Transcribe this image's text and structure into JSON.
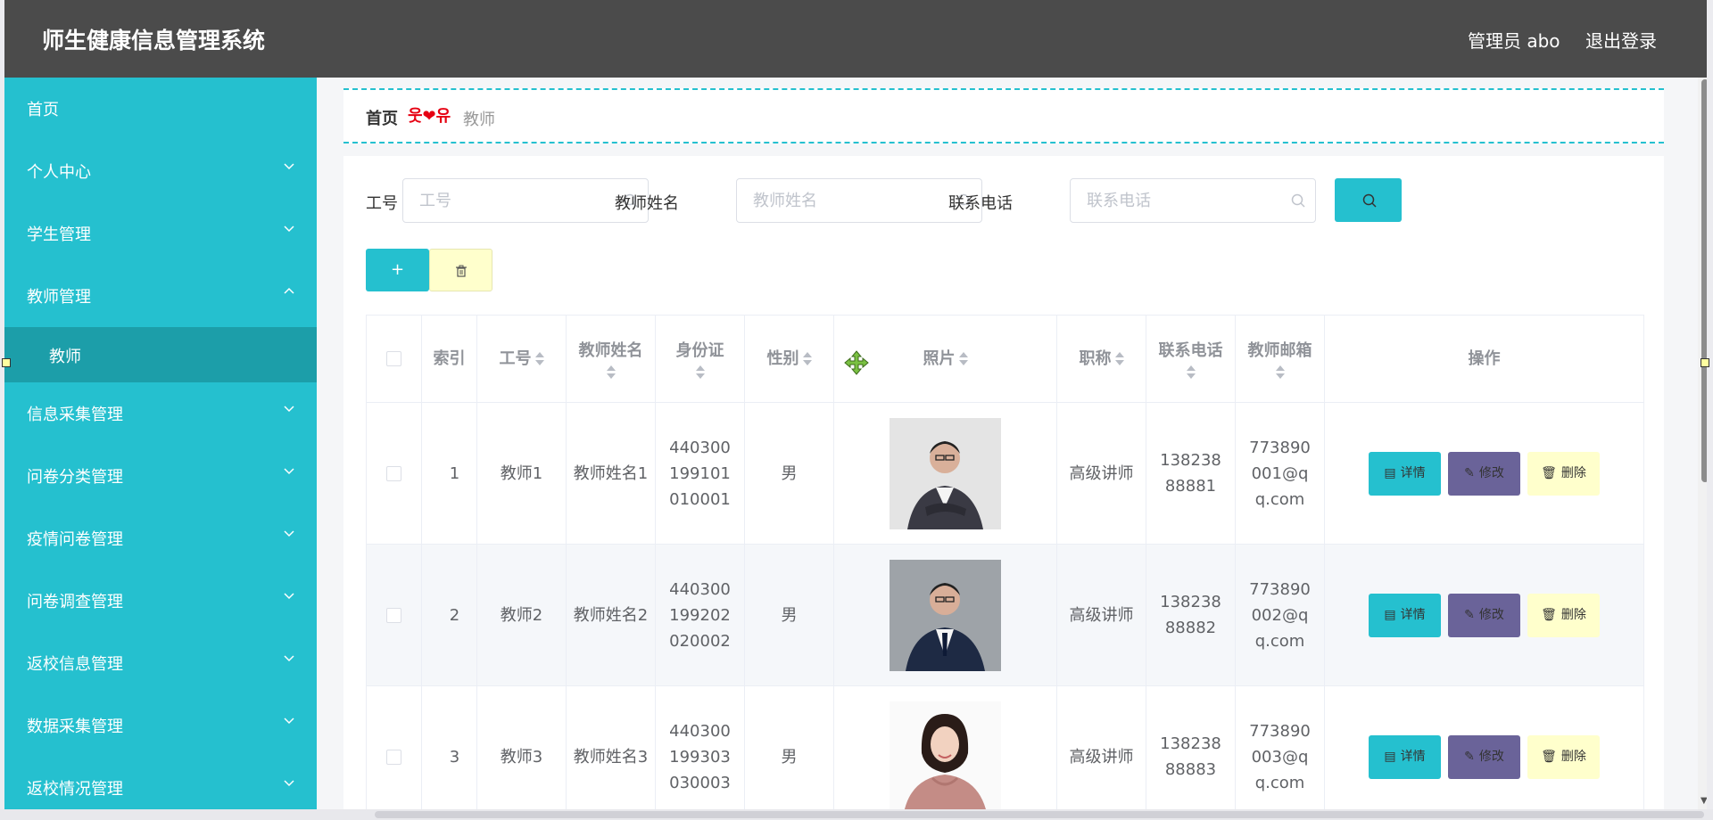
{
  "header": {
    "title": "师生健康信息管理系统",
    "user": "管理员 abo",
    "logout": "退出登录"
  },
  "sidebar": {
    "items": [
      {
        "label": "首页"
      },
      {
        "label": "个人中心"
      },
      {
        "label": "学生管理"
      },
      {
        "label": "教师管理",
        "expanded": true
      },
      {
        "label": "信息采集管理"
      },
      {
        "label": "问卷分类管理"
      },
      {
        "label": "疫情问卷管理"
      },
      {
        "label": "问卷调查管理"
      },
      {
        "label": "返校信息管理"
      },
      {
        "label": "数据采集管理"
      },
      {
        "label": "返校情况管理"
      }
    ],
    "submenu_active": "教师"
  },
  "breadcrumb": {
    "home": "首页",
    "separator": "웃❤유",
    "current": "教师"
  },
  "search": {
    "fields": [
      {
        "label": "工号",
        "placeholder": "工号",
        "value": ""
      },
      {
        "label": "教师姓名",
        "placeholder": "教师姓名",
        "value": ""
      },
      {
        "label": "联系电话",
        "placeholder": "联系电话",
        "value": ""
      }
    ]
  },
  "toolbar": {
    "add_label": "+"
  },
  "table": {
    "headers": [
      "索引",
      "工号",
      "教师姓名",
      "身份证",
      "性别",
      "照片",
      "职称",
      "联系电话",
      "教师邮箱",
      "操作"
    ],
    "rows": [
      {
        "index": "1",
        "id": "教师1",
        "name": "教师姓名1",
        "idcard": "440300199101010001",
        "gender": "男",
        "title": "高级讲师",
        "phone": "13823888881",
        "email": "773890001@qq.com",
        "photo": "male-suit-crossed-arms"
      },
      {
        "index": "2",
        "id": "教师2",
        "name": "教师姓名2",
        "idcard": "440300199202020002",
        "gender": "男",
        "title": "高级讲师",
        "phone": "13823888882",
        "email": "773890002@qq.com",
        "photo": "male-suit-tie"
      },
      {
        "index": "3",
        "id": "教师3",
        "name": "教师姓名3",
        "idcard": "440300199303030003",
        "gender": "男",
        "title": "高级讲师",
        "phone": "13823888883",
        "email": "773890003@qq.com",
        "photo": "female-blouse"
      }
    ],
    "actions": {
      "detail": "详情",
      "edit": "修改",
      "delete": "删除"
    }
  },
  "colors": {
    "accent": "#25c0cf",
    "header_bg": "#4b4b4b",
    "edit_btn": "#6a6399",
    "delete_btn": "#ffffcc"
  }
}
